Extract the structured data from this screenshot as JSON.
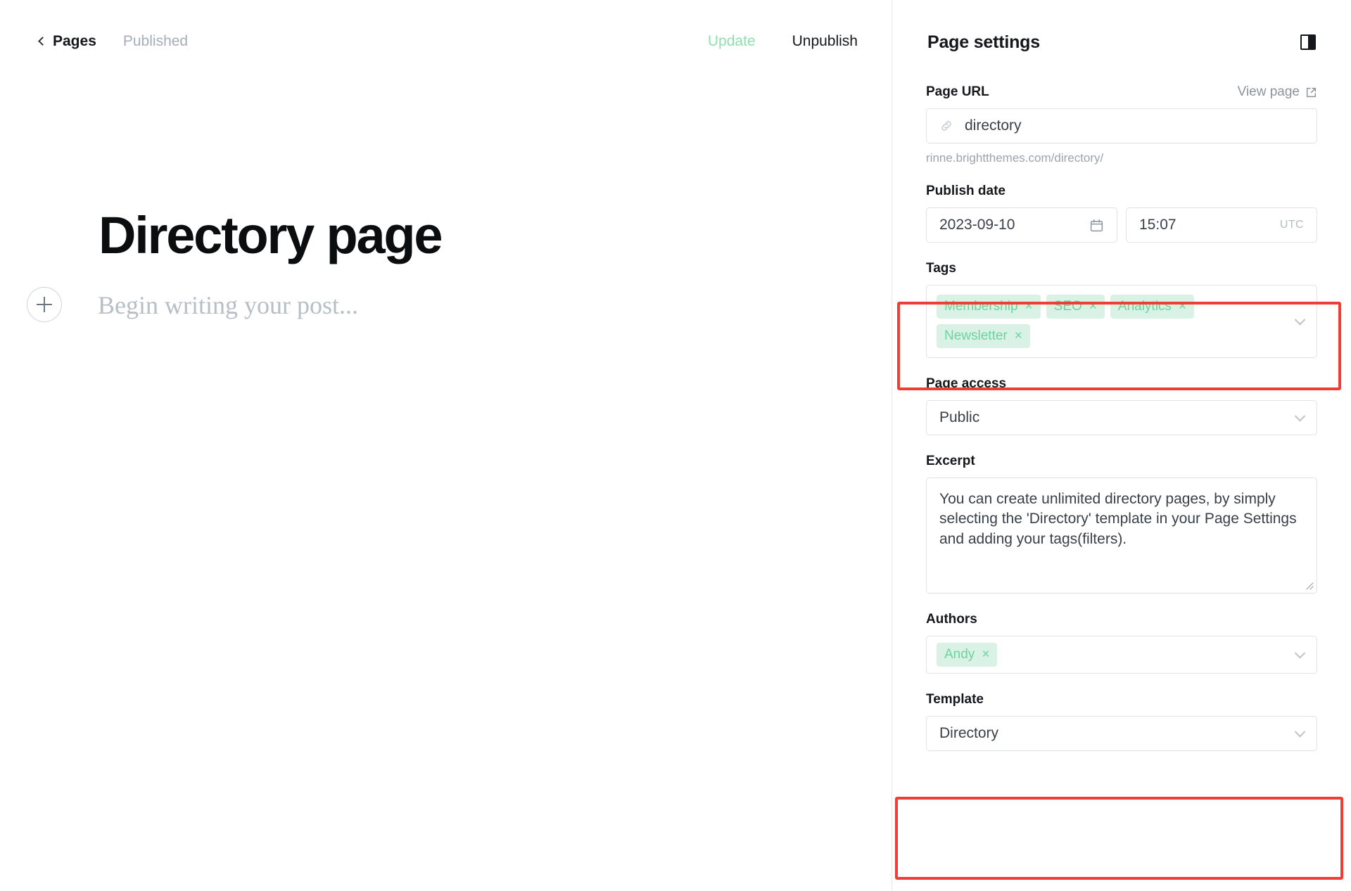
{
  "editor": {
    "topbar": {
      "back_label": "Pages",
      "status": "Published",
      "update_label": "Update",
      "unpublish_label": "Unpublish"
    },
    "document": {
      "title": "Directory page",
      "body_placeholder": "Begin writing your post..."
    }
  },
  "settings": {
    "title": "Page settings",
    "page_url": {
      "label": "Page URL",
      "view_page_label": "View page",
      "value": "directory",
      "hint": "rinne.brightthemes.com/directory/"
    },
    "publish_date": {
      "label": "Publish date",
      "date": "2023-09-10",
      "time": "15:07",
      "timezone": "UTC"
    },
    "tags": {
      "label": "Tags",
      "items": [
        {
          "name": "Membership",
          "remove": "×"
        },
        {
          "name": "SEO",
          "remove": "×"
        },
        {
          "name": "Analytics",
          "remove": "×"
        },
        {
          "name": "Newsletter",
          "remove": "×"
        }
      ]
    },
    "page_access": {
      "label": "Page access",
      "value": "Public"
    },
    "excerpt": {
      "label": "Excerpt",
      "value": "You can create unlimited directory pages, by simply selecting the 'Directory' template in your Page Settings and adding your tags(filters)."
    },
    "authors": {
      "label": "Authors",
      "items": [
        {
          "name": "Andy",
          "remove": "×"
        }
      ]
    },
    "template": {
      "label": "Template",
      "value": "Directory"
    }
  },
  "colors": {
    "accent_green": "#8fdfae",
    "chip_bg": "#d9f2e5",
    "chip_text": "#6ed3a3",
    "highlight_red": "#ef3e36",
    "text_primary": "#15171a",
    "text_muted": "#8b949d"
  }
}
